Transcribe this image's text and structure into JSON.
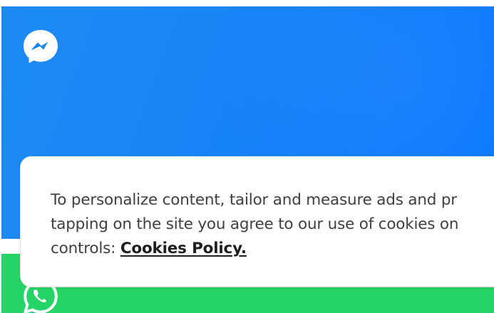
{
  "icons": {
    "messenger": "messenger-icon",
    "whatsapp": "whatsapp-icon"
  },
  "colors": {
    "messenger_blue": "#1a86f6",
    "whatsapp_green": "#25d366",
    "banner_background": "#ffffff",
    "banner_text": "#3c4043",
    "link_text": "#1c1e21"
  },
  "cookie_banner": {
    "line1": "To personalize content, tailor and measure ads and pr",
    "line2": "tapping on the site you agree to our use of cookies on",
    "line3_prefix": "controls: ",
    "link_label": "Cookies Policy."
  }
}
